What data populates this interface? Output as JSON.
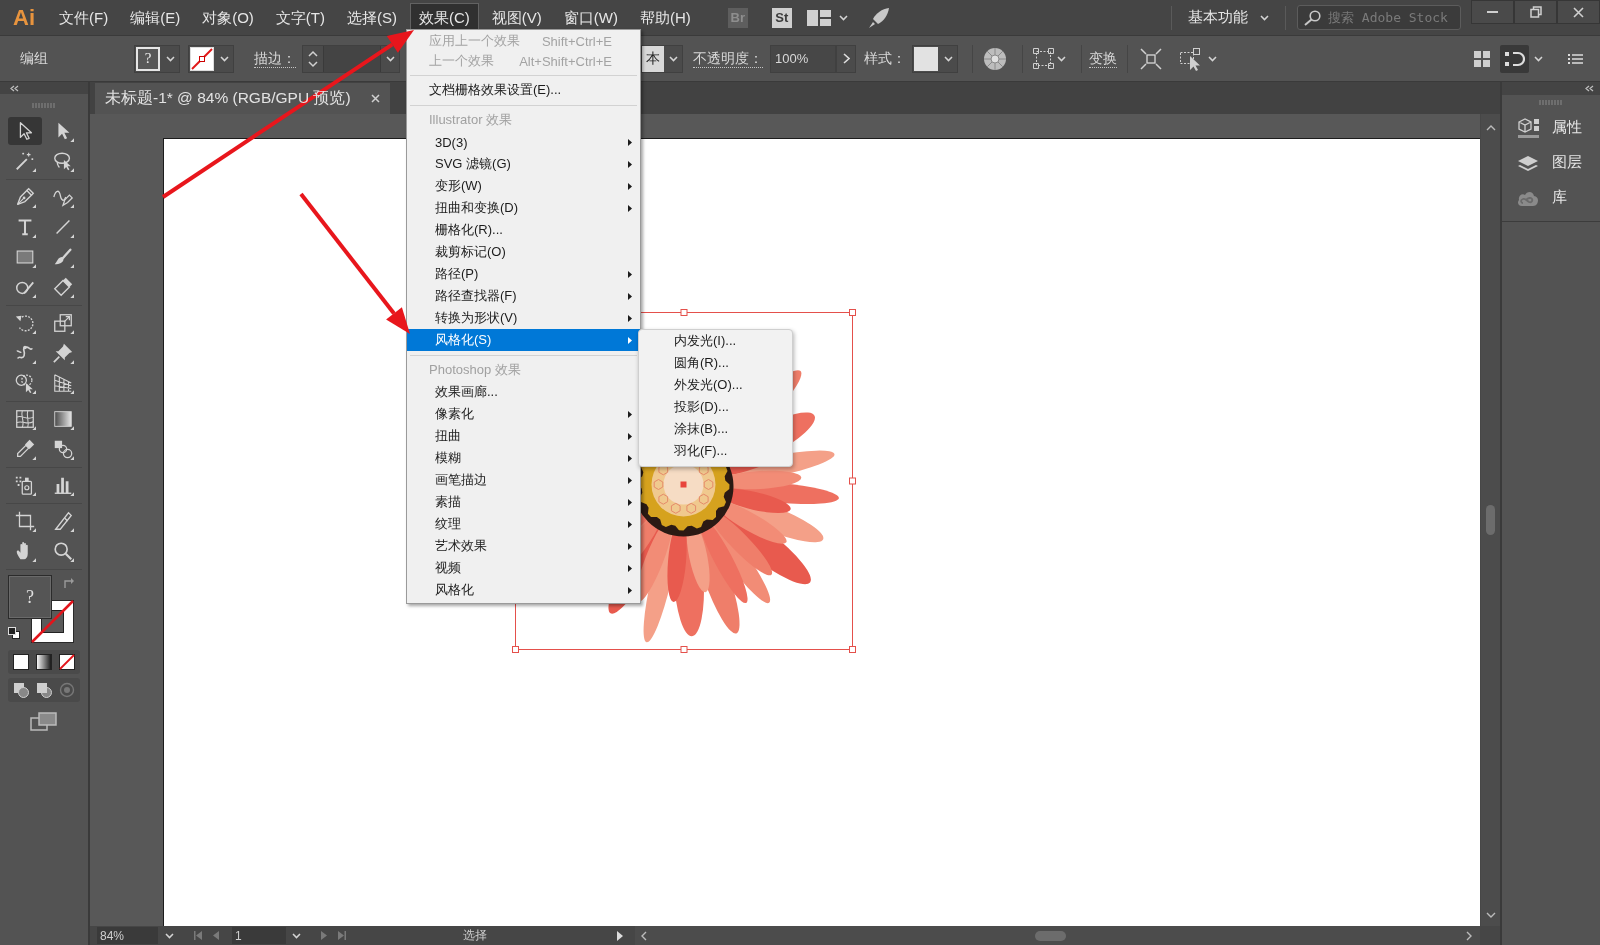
{
  "menu_bar": {
    "logo": "Ai",
    "items": [
      {
        "label": "文件(F)",
        "selected": false
      },
      {
        "label": "编辑(E)",
        "selected": false
      },
      {
        "label": "对象(O)",
        "selected": false
      },
      {
        "label": "文字(T)",
        "selected": false
      },
      {
        "label": "选择(S)",
        "selected": false
      },
      {
        "label": "效果(C)",
        "selected": true
      },
      {
        "label": "视图(V)",
        "selected": false
      },
      {
        "label": "窗口(W)",
        "selected": false
      },
      {
        "label": "帮助(H)",
        "selected": false
      }
    ],
    "launchers": [
      {
        "label": "Br",
        "disabled": true
      },
      {
        "label": "St",
        "disabled": false
      }
    ],
    "workspace": "基本功能",
    "search": {
      "placeholder": "搜索 Adobe Stock"
    }
  },
  "control_bar": {
    "selection_type": "编组",
    "fill_swatch": "?",
    "stroke_label": "描边：",
    "brush_partial": "本",
    "opacity_label": "不透明度：",
    "opacity": "100%",
    "style_label": "样式：",
    "transform_label": "变换"
  },
  "toolbar": {
    "groups": [
      {
        "tools": [
          {
            "kind": "select",
            "selected": true
          },
          {
            "kind": "direct",
            "selected": false
          },
          {
            "kind": "wand",
            "selected": false
          },
          {
            "kind": "lasso",
            "selected": false
          }
        ]
      },
      {
        "tools": [
          {
            "kind": "pen",
            "selected": false
          },
          {
            "kind": "curvature",
            "selected": false
          },
          {
            "kind": "type",
            "selected": false
          },
          {
            "kind": "line",
            "selected": false
          },
          {
            "kind": "rectangle",
            "selected": false
          },
          {
            "kind": "brush",
            "selected": false
          },
          {
            "kind": "shaper",
            "selected": false
          },
          {
            "kind": "eraser",
            "selected": false
          }
        ]
      },
      {
        "tools": [
          {
            "kind": "rotate",
            "selected": false
          },
          {
            "kind": "scale",
            "selected": false
          },
          {
            "kind": "warp",
            "selected": false
          },
          {
            "kind": "pin",
            "selected": false
          },
          {
            "kind": "builder",
            "selected": false
          },
          {
            "kind": "perspective",
            "selected": false
          }
        ]
      },
      {
        "tools": [
          {
            "kind": "mesh",
            "selected": false
          },
          {
            "kind": "gradient",
            "selected": false
          },
          {
            "kind": "eyedropper",
            "selected": false
          },
          {
            "kind": "blend",
            "selected": false
          }
        ]
      },
      {
        "tools": [
          {
            "kind": "sprayer",
            "selected": false
          },
          {
            "kind": "graph",
            "selected": false
          }
        ]
      },
      {
        "tools": [
          {
            "kind": "artboard",
            "selected": false
          },
          {
            "kind": "slice",
            "selected": false
          },
          {
            "kind": "hand",
            "selected": false
          },
          {
            "kind": "zoom",
            "selected": false
          }
        ]
      }
    ],
    "fill_swatch": "?"
  },
  "document_tab": {
    "title": "未标题-1* @ 84% (RGB/GPU 预览)"
  },
  "artwork": {
    "selected": true
  },
  "effect_menu": {
    "groups": [
      {
        "items": [
          {
            "label": "应用上一个效果",
            "shortcut": "Shift+Ctrl+E",
            "disabled": true,
            "selected": false,
            "submenu": false
          },
          {
            "label": "上一个效果",
            "shortcut": "Alt+Shift+Ctrl+E",
            "disabled": true,
            "selected": false,
            "submenu": false
          }
        ]
      },
      {
        "items": [
          {
            "label": "文档栅格效果设置(E)...",
            "disabled": false,
            "selected": false,
            "submenu": false
          }
        ]
      },
      {
        "header": "Illustrator 效果",
        "items": [
          {
            "label": "3D(3)",
            "disabled": false,
            "selected": false,
            "submenu": true
          },
          {
            "label": "SVG 滤镜(G)",
            "disabled": false,
            "selected": false,
            "submenu": true
          },
          {
            "label": "变形(W)",
            "disabled": false,
            "selected": false,
            "submenu": true
          },
          {
            "label": "扭曲和变换(D)",
            "disabled": false,
            "selected": false,
            "submenu": true
          },
          {
            "label": "栅格化(R)...",
            "disabled": false,
            "selected": false,
            "submenu": false
          },
          {
            "label": "裁剪标记(O)",
            "disabled": false,
            "selected": false,
            "submenu": false
          },
          {
            "label": "路径(P)",
            "disabled": false,
            "selected": false,
            "submenu": true
          },
          {
            "label": "路径查找器(F)",
            "disabled": false,
            "selected": false,
            "submenu": true
          },
          {
            "label": "转换为形状(V)",
            "disabled": false,
            "selected": false,
            "submenu": true
          },
          {
            "label": "风格化(S)",
            "disabled": false,
            "selected": true,
            "submenu": true
          }
        ]
      },
      {
        "header": "Photoshop 效果",
        "items": [
          {
            "label": "效果画廊...",
            "disabled": false,
            "selected": false,
            "submenu": false
          },
          {
            "label": "像素化",
            "disabled": false,
            "selected": false,
            "submenu": true
          },
          {
            "label": "扭曲",
            "disabled": false,
            "selected": false,
            "submenu": true
          },
          {
            "label": "模糊",
            "disabled": false,
            "selected": false,
            "submenu": true
          },
          {
            "label": "画笔描边",
            "disabled": false,
            "selected": false,
            "submenu": true
          },
          {
            "label": "素描",
            "disabled": false,
            "selected": false,
            "submenu": true
          },
          {
            "label": "纹理",
            "disabled": false,
            "selected": false,
            "submenu": true
          },
          {
            "label": "艺术效果",
            "disabled": false,
            "selected": false,
            "submenu": true
          },
          {
            "label": "视频",
            "disabled": false,
            "selected": false,
            "submenu": true
          },
          {
            "label": "风格化",
            "disabled": false,
            "selected": false,
            "submenu": true
          }
        ]
      }
    ]
  },
  "stylize_submenu": {
    "items": [
      {
        "label": "内发光(I)...",
        "selected": false
      },
      {
        "label": "圆角(R)...",
        "selected": false
      },
      {
        "label": "外发光(O)...",
        "selected": false
      },
      {
        "label": "投影(D)...",
        "selected": false
      },
      {
        "label": "涂抹(B)...",
        "selected": false
      },
      {
        "label": "羽化(F)...",
        "selected": false
      }
    ]
  },
  "panels": {
    "tabs": [
      {
        "kind": "properties",
        "label": "属性"
      },
      {
        "kind": "layers",
        "label": "图层"
      },
      {
        "kind": "libraries",
        "label": "库"
      }
    ]
  },
  "status_bar": {
    "zoom": "84%",
    "artboard": "1",
    "tool": "选择"
  }
}
